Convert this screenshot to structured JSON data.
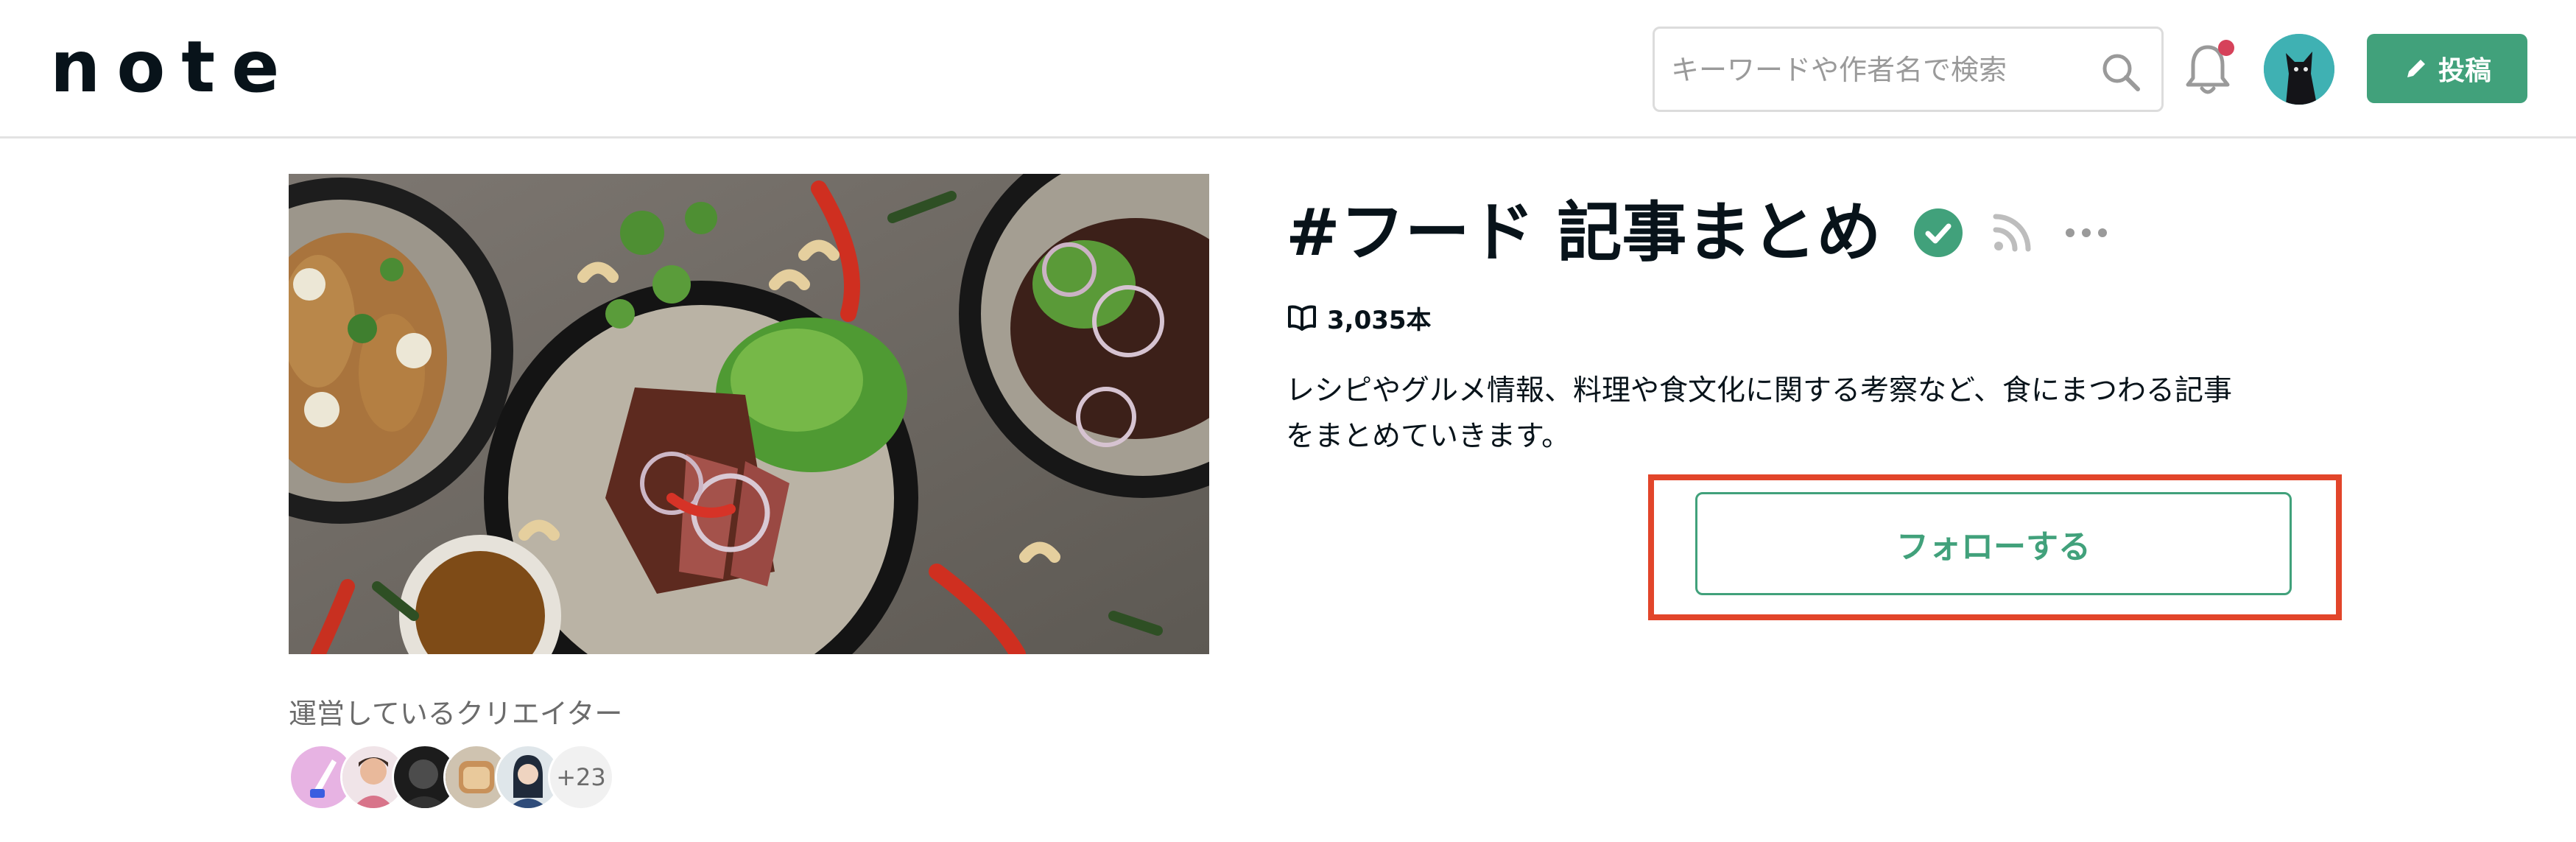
{
  "header": {
    "logo_text": "note",
    "search_placeholder": "キーワードや作者名で検索",
    "post_label": "投稿",
    "notification_unread": true
  },
  "magazine": {
    "title": "#フード 記事まとめ",
    "article_count": "3,035本",
    "description_line1": "レシピやグルメ情報、料理や食文化に関する考察など、食にまつわる記事",
    "description_line2": "をまとめていきます。",
    "follow_label": "フォローする"
  },
  "creators": {
    "label": "運営しているクリエイター",
    "more_count": "+23"
  },
  "colors": {
    "brand_green": "#41a17b",
    "highlight_red": "#e2452a",
    "notification_dot": "#d6425a",
    "text_dark": "#08131a",
    "text_gray": "#6b6b6b"
  }
}
